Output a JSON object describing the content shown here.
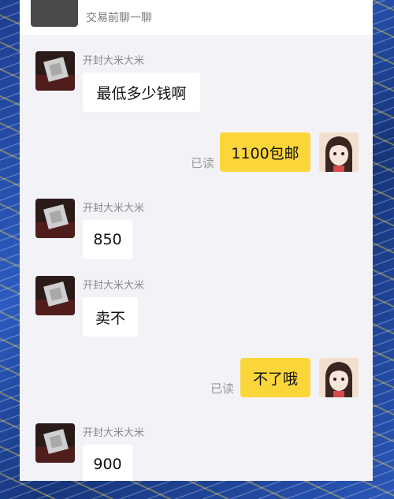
{
  "header": {
    "preview_text": "交易前聊一聊"
  },
  "seller": {
    "name": "开封大米大米"
  },
  "messages": [
    {
      "from": "seller",
      "text": "最低多少钱啊"
    },
    {
      "from": "me",
      "text": "1100包邮",
      "status": "已读"
    },
    {
      "from": "seller",
      "text": "850"
    },
    {
      "from": "seller",
      "text": "卖不"
    },
    {
      "from": "me",
      "text": "不了哦",
      "status": "已读"
    },
    {
      "from": "seller",
      "text": "900"
    }
  ],
  "colors": {
    "outgoing_bubble": "#fbd63a",
    "incoming_bubble": "#ffffff",
    "panel_bg": "#f3f3f7"
  }
}
